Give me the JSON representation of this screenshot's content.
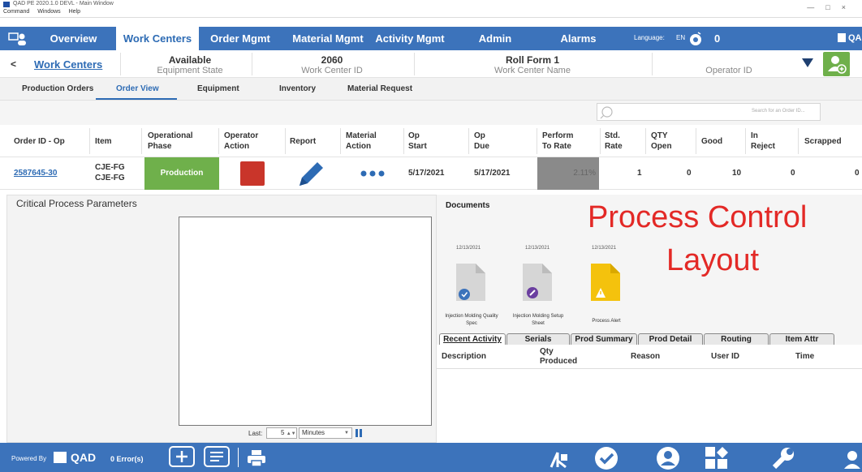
{
  "window": {
    "title": "QAD PE 2020.1.0 DEVL - Main Window",
    "menu": [
      "Command",
      "Windows",
      "Help"
    ]
  },
  "nav": {
    "tabs": [
      "Overview",
      "Work Centers",
      "Order Mgmt",
      "Material Mgmt",
      "Activity Mgmt",
      "Admin",
      "Alarms"
    ],
    "active_tab": "Work Centers",
    "language_label": "Language:",
    "language_value": "EN",
    "alarm_count": "0",
    "brand": "QA"
  },
  "info": {
    "back": "<",
    "breadcrumb": "Work Centers",
    "state_value": "Available",
    "state_label": "Equipment State",
    "wc_id_value": "2060",
    "wc_id_label": "Work Center ID",
    "wc_name_value": "Roll Form 1",
    "wc_name_label": "Work Center Name",
    "operator_label": "Operator ID"
  },
  "subtabs": [
    "Production Orders",
    "Order View",
    "Equipment",
    "Inventory",
    "Material Request"
  ],
  "search": {
    "placeholder": "Search for an Order ID..."
  },
  "table": {
    "headers": {
      "order": "Order ID - Op",
      "item": "Item",
      "phase_1": "Operational",
      "phase_2": "Phase",
      "opaction_1": "Operator",
      "opaction_2": "Action",
      "report": "Report",
      "matact_1": "Material",
      "matact_2": "Action",
      "opstart_1": "Op",
      "opstart_2": "Start",
      "opdue_1": "Op",
      "opdue_2": "Due",
      "perf_1": "Perform",
      "perf_2": "To Rate",
      "std_1": "Std.",
      "std_2": "Rate",
      "qty_1": "QTY",
      "qty_2": "Open",
      "good": "Good",
      "reject_1": "In",
      "reject_2": "Reject",
      "scrapped": "Scrapped"
    },
    "row": {
      "order": "2587645-30",
      "item_1": "CJE-FG",
      "item_2": "CJE-FG",
      "phase": "Production",
      "op_start": "5/17/2021",
      "op_due": "5/17/2021",
      "perform": "2.11%",
      "std_rate": "1",
      "qty_open": "0",
      "good": "10",
      "in_reject": "0",
      "scrapped": "0"
    }
  },
  "cpp": {
    "title": "Critical Process Parameters",
    "last_label": "Last:",
    "last_value": "5",
    "unit": "Minutes"
  },
  "documents": {
    "title": "Documents",
    "items": [
      {
        "date": "12/13/2021",
        "name_1": "Injection Molding Quality",
        "name_2": "Spec"
      },
      {
        "date": "12/13/2021",
        "name_1": "Injection Molding Setup",
        "name_2": "Sheet"
      },
      {
        "date": "12/13/2021",
        "name_1": "Process Alert",
        "name_2": ""
      }
    ]
  },
  "overlay": {
    "line1": "Process Control",
    "line2": "Layout"
  },
  "detail_tabs": [
    "Recent Activity",
    "Serials",
    "Prod Summary",
    "Prod Detail",
    "Routing",
    "Item Attr"
  ],
  "activity": {
    "headers": {
      "description": "Description",
      "qty_1": "Qty",
      "qty_2": "Produced",
      "reason": "Reason",
      "user": "User ID",
      "time": "Time"
    }
  },
  "footer": {
    "powered": "Powered By",
    "brand": "QAD",
    "errors": "0 Error(s)"
  },
  "colors": {
    "nav_blue": "#3c73bb",
    "production_green": "#6fb04b",
    "stop_red": "#c9352a",
    "overlay_red": "#e32926"
  }
}
